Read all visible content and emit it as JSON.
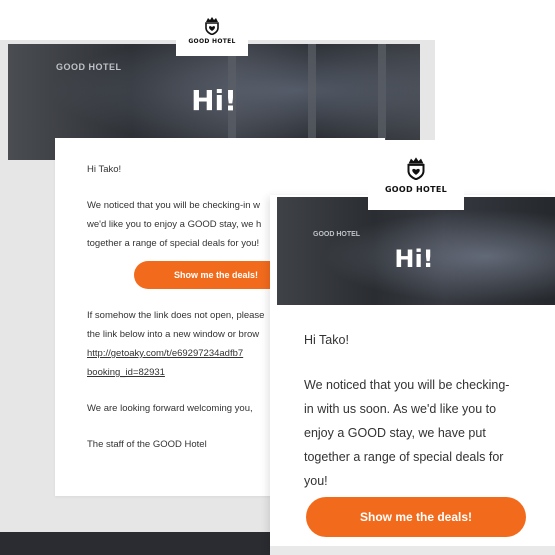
{
  "brand": {
    "name": "GOOD HOTEL",
    "accent": "#f26b1d",
    "link_color": "#2ea7e0"
  },
  "desktop_email": {
    "hero_greeting": "Hi!",
    "wall_sign": "GOOD HOTEL",
    "salutation": "Hi Tako!",
    "paragraph_lines": [
      "We noticed that you will be checking-in w",
      "we'd like you to enjoy a GOOD stay, we h",
      "together a range of special deals for you!"
    ],
    "cta_label": "Show me the deals!",
    "fallback_lines": [
      "If somehow the link does not open, please",
      "the link below into a new window or brow"
    ],
    "link_lines": [
      "http://getoaky.com/t/e69297234adfb7",
      "booking_id=82931"
    ],
    "closing": "We are looking forward welcoming you,",
    "signature": "The staff of the GOOD Hotel"
  },
  "mobile_email": {
    "hero_greeting": "Hi!",
    "salutation": "Hi Tako!",
    "paragraph_lines": [
      "We noticed that you will be checking-",
      "in with us soon. As we'd like you to",
      "enjoy a GOOD stay, we have put",
      "together a range of special deals for",
      "you!"
    ],
    "cta_label": "Show me the deals!"
  }
}
